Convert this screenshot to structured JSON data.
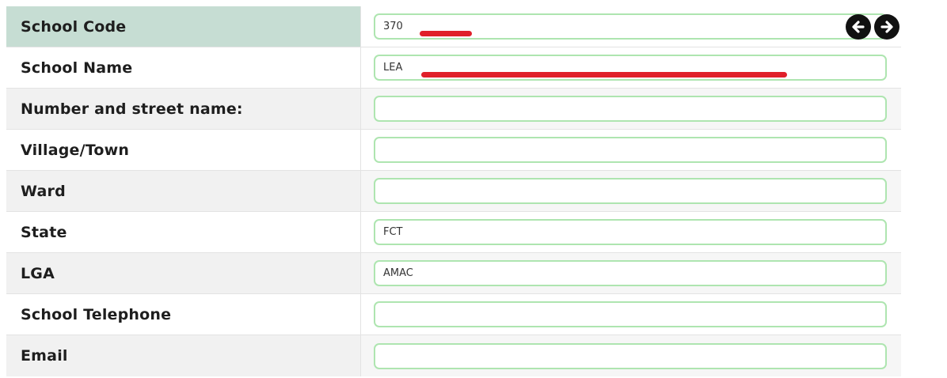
{
  "form": {
    "rows": [
      {
        "label": "School Code",
        "value": "370"
      },
      {
        "label": "School Name",
        "value": "LEA"
      },
      {
        "label": "Number and street name:",
        "value": ""
      },
      {
        "label": "Village/Town",
        "value": ""
      },
      {
        "label": "Ward",
        "value": ""
      },
      {
        "label": "State",
        "value": "FCT"
      },
      {
        "label": "LGA",
        "value": "AMAC"
      },
      {
        "label": "School Telephone",
        "value": ""
      },
      {
        "label": "Email",
        "value": ""
      }
    ]
  },
  "nav": {
    "prev_icon": "arrow-left-circle-icon",
    "next_icon": "arrow-right-circle-icon"
  },
  "colors": {
    "header_bg": "#c6ddd3",
    "field_border": "#aee5b0",
    "redaction": "#e0202a",
    "alt_row_bg": "#f1f1f1"
  }
}
